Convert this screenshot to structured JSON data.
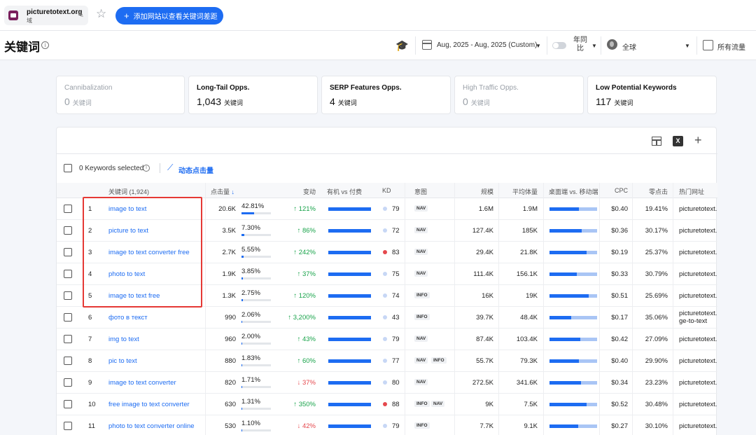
{
  "topbar": {
    "site_name": "picturetotext.org",
    "site_sub": "域",
    "compare_label": "添加网站以查看关键词差距"
  },
  "header": {
    "title": "关键词",
    "date_range": "Aug, 2025 - Aug, 2025 (Custom)",
    "yoy_label": "年同比",
    "region": "全球",
    "traffic": "所有流量"
  },
  "cards": [
    {
      "title": "Cannibalization",
      "value": "0",
      "unit": "关键词",
      "muted": true
    },
    {
      "title": "Long-Tail Opps.",
      "value": "1,043",
      "unit": "关键词",
      "muted": false
    },
    {
      "title": "SERP Features Opps.",
      "value": "4",
      "unit": "关键词",
      "muted": false
    },
    {
      "title": "High Traffic Opps.",
      "value": "0",
      "unit": "关键词",
      "muted": true
    },
    {
      "title": "Low Potential Keywords",
      "value": "117",
      "unit": "关键词",
      "muted": false
    }
  ],
  "toolbar": {
    "selected": "0 Keywords selected",
    "dynamic": "动态点击量",
    "excel_label": "X"
  },
  "columns": {
    "keyword": "关键词 (1,924)",
    "clicks": "点击量",
    "change": "变动",
    "organic_paid": "有机 vs 付费",
    "kd": "KD",
    "intent": "意图",
    "volume": "规模",
    "avg_volume": "平均体量",
    "desktop_mobile": "桌面端 vs. 移动端",
    "cpc": "CPC",
    "zero_click": "零点击",
    "top_url": "热门网址"
  },
  "rows": [
    {
      "n": "1",
      "kw": "image to text",
      "clicks": "20.6K",
      "pct": "42.81%",
      "pv": 0.43,
      "chg": "↑ 121%",
      "up": true,
      "kd": "79",
      "red": false,
      "tags": [
        "NAV"
      ],
      "vol": "1.6M",
      "avg": "1.9M",
      "dm": 0.62,
      "cpc": "$0.40",
      "zc": "19.41%",
      "url": "picturetotext.",
      "url2": ""
    },
    {
      "n": "2",
      "kw": "picture to text",
      "clicks": "3.5K",
      "pct": "7.30%",
      "pv": 0.09,
      "chg": "↑ 86%",
      "up": true,
      "kd": "72",
      "red": false,
      "tags": [
        "NAV"
      ],
      "vol": "127.4K",
      "avg": "185K",
      "dm": 0.68,
      "cpc": "$0.36",
      "zc": "30.17%",
      "url": "picturetotext.",
      "url2": ""
    },
    {
      "n": "3",
      "kw": "image to text converter free",
      "clicks": "2.7K",
      "pct": "5.55%",
      "pv": 0.07,
      "chg": "↑ 242%",
      "up": true,
      "kd": "83",
      "red": true,
      "tags": [
        "NAV"
      ],
      "vol": "29.4K",
      "avg": "21.8K",
      "dm": 0.78,
      "cpc": "$0.19",
      "zc": "25.37%",
      "url": "picturetotext.",
      "url2": ""
    },
    {
      "n": "4",
      "kw": "photo to text",
      "clicks": "1.9K",
      "pct": "3.85%",
      "pv": 0.05,
      "chg": "↑ 37%",
      "up": true,
      "kd": "75",
      "red": false,
      "tags": [
        "NAV"
      ],
      "vol": "111.4K",
      "avg": "156.1K",
      "dm": 0.58,
      "cpc": "$0.33",
      "zc": "30.79%",
      "url": "picturetotext.",
      "url2": ""
    },
    {
      "n": "5",
      "kw": "image to text free",
      "clicks": "1.3K",
      "pct": "2.75%",
      "pv": 0.035,
      "chg": "↑ 120%",
      "up": true,
      "kd": "74",
      "red": false,
      "tags": [
        "INFO"
      ],
      "vol": "16K",
      "avg": "19K",
      "dm": 0.82,
      "cpc": "$0.51",
      "zc": "25.69%",
      "url": "picturetotext.",
      "url2": ""
    },
    {
      "n": "6",
      "kw": "фото в текст",
      "clicks": "990",
      "pct": "2.06%",
      "pv": 0.027,
      "chg": "↑ 3,200%",
      "up": true,
      "kd": "43",
      "red": false,
      "tags": [
        "INFO"
      ],
      "vol": "39.7K",
      "avg": "48.4K",
      "dm": 0.45,
      "cpc": "$0.17",
      "zc": "35.06%",
      "url": "picturetotext.",
      "url2": "ge-to-text"
    },
    {
      "n": "7",
      "kw": "img to text",
      "clicks": "960",
      "pct": "2.00%",
      "pv": 0.026,
      "chg": "↑ 43%",
      "up": true,
      "kd": "79",
      "red": false,
      "tags": [
        "NAV"
      ],
      "vol": "87.4K",
      "avg": "103.4K",
      "dm": 0.65,
      "cpc": "$0.42",
      "zc": "27.09%",
      "url": "picturetotext.",
      "url2": ""
    },
    {
      "n": "8",
      "kw": "pic to text",
      "clicks": "880",
      "pct": "1.83%",
      "pv": 0.024,
      "chg": "↑ 60%",
      "up": true,
      "kd": "77",
      "red": false,
      "tags": [
        "NAV",
        "INFO"
      ],
      "vol": "55.7K",
      "avg": "79.3K",
      "dm": 0.62,
      "cpc": "$0.40",
      "zc": "29.90%",
      "url": "picturetotext.",
      "url2": ""
    },
    {
      "n": "9",
      "kw": "image to text converter",
      "clicks": "820",
      "pct": "1.71%",
      "pv": 0.022,
      "chg": "↓ 37%",
      "up": false,
      "kd": "80",
      "red": false,
      "tags": [
        "NAV"
      ],
      "vol": "272.5K",
      "avg": "341.6K",
      "dm": 0.66,
      "cpc": "$0.34",
      "zc": "23.23%",
      "url": "picturetotext.",
      "url2": ""
    },
    {
      "n": "10",
      "kw": "free image to text converter",
      "clicks": "630",
      "pct": "1.31%",
      "pv": 0.017,
      "chg": "↑ 350%",
      "up": true,
      "kd": "88",
      "red": true,
      "tags": [
        "INFO",
        "NAV"
      ],
      "vol": "9K",
      "avg": "7.5K",
      "dm": 0.78,
      "cpc": "$0.52",
      "zc": "30.48%",
      "url": "picturetotext.",
      "url2": ""
    },
    {
      "n": "11",
      "kw": "photo to text converter online",
      "clicks": "530",
      "pct": "1.10%",
      "pv": 0.014,
      "chg": "↓ 42%",
      "up": false,
      "kd": "79",
      "red": false,
      "tags": [
        "INFO"
      ],
      "vol": "7.7K",
      "avg": "9.1K",
      "dm": 0.6,
      "cpc": "$0.27",
      "zc": "30.10%",
      "url": "picturetotext.",
      "url2": ""
    }
  ]
}
